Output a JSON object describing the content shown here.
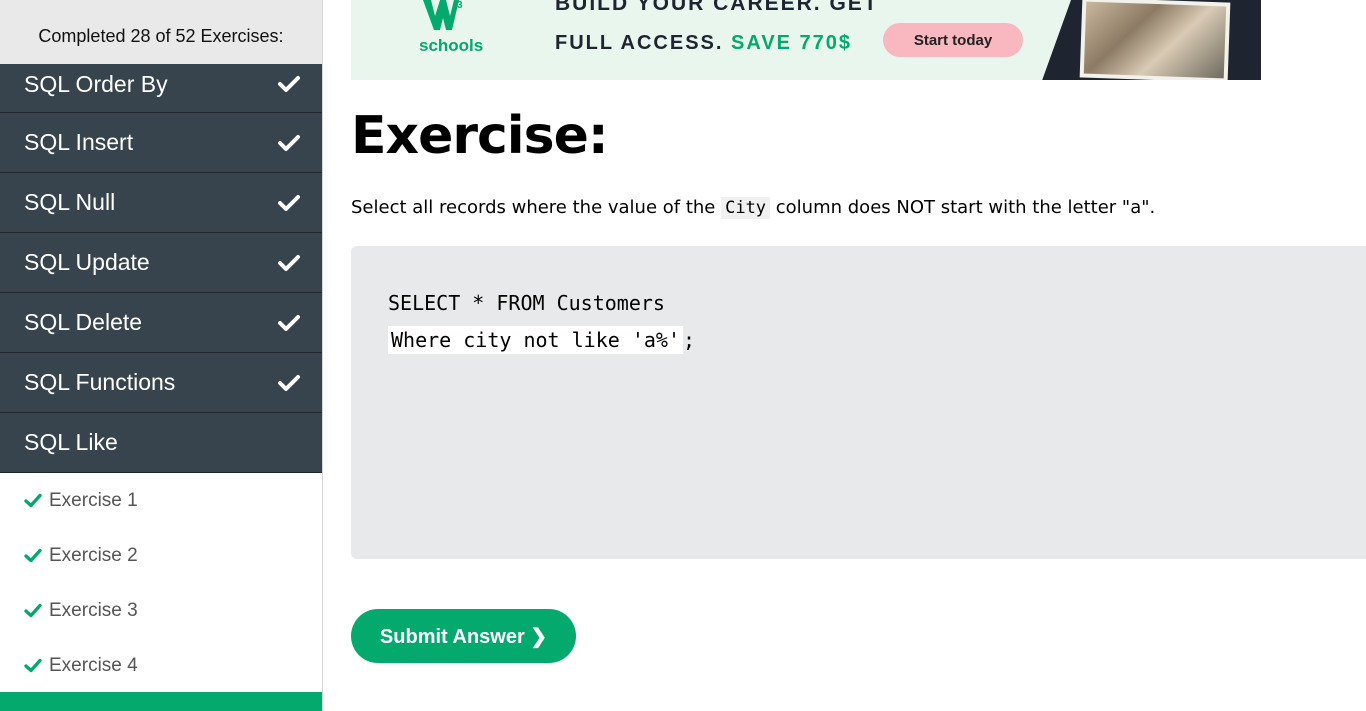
{
  "sidebar": {
    "progress_text": "Completed 28 of 52 Exercises:",
    "topics": [
      {
        "label": "SQL Order By",
        "completed": true
      },
      {
        "label": "SQL Insert",
        "completed": true
      },
      {
        "label": "SQL Null",
        "completed": true
      },
      {
        "label": "SQL Update",
        "completed": true
      },
      {
        "label": "SQL Delete",
        "completed": true
      },
      {
        "label": "SQL Functions",
        "completed": true
      },
      {
        "label": "SQL Like",
        "completed": false
      }
    ],
    "exercises": [
      {
        "label": "Exercise 1",
        "completed": true
      },
      {
        "label": "Exercise 2",
        "completed": true
      },
      {
        "label": "Exercise 3",
        "completed": true
      },
      {
        "label": "Exercise 4",
        "completed": true
      }
    ]
  },
  "ad": {
    "logo_text": "schools",
    "line1": "BUILD YOUR CAREER. GET",
    "line2_prefix": "FULL ACCESS.",
    "line2_highlight": "SAVE 770$",
    "button_label": "Start today"
  },
  "main": {
    "title": "Exercise:",
    "instruction_before": "Select all records where the value of the ",
    "instruction_code": "City",
    "instruction_after": " column does NOT start with the letter \"a\".",
    "code_line1": "SELECT * FROM Customers",
    "code_input_value": "Where city not like 'a%'",
    "code_suffix": ";",
    "submit_label": "Submit Answer ❯"
  },
  "colors": {
    "sidebar_topic_bg": "#38444d",
    "accent_green": "#04aa6d",
    "code_box_bg": "#e7e9eb"
  }
}
